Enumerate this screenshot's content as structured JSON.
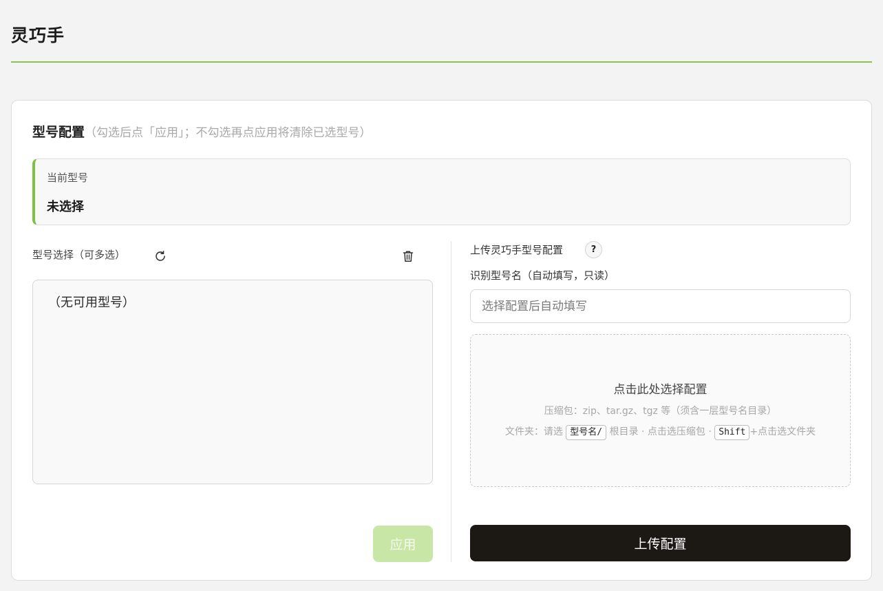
{
  "app": {
    "title": "灵巧手"
  },
  "config": {
    "title": "型号配置",
    "hint": "（勾选后点「应用」；不勾选再点应用将清除已选型号）"
  },
  "current": {
    "label": "当前型号",
    "value": "未选择"
  },
  "selector": {
    "label": "型号选择（可多选）",
    "empty": "（无可用型号）",
    "apply_label": "应用",
    "refresh_icon": "refresh-icon",
    "trash_icon": "trash-icon"
  },
  "upload": {
    "title": "上传灵巧手型号配置",
    "help": "?",
    "name_label": "识别型号名（自动填写，只读）",
    "name_placeholder": "选择配置后自动填写",
    "drop_main": "点击此处选择配置",
    "drop_sub1": "压缩包：zip、tar.gz、tgz 等（须含一层型号名目录）",
    "drop_sub2_a": "文件夹：请选",
    "drop_sub2_kbd1": "型号名/",
    "drop_sub2_b": "根目录 · 点击选压缩包 ·",
    "drop_sub2_kbd2": "Shift",
    "drop_sub2_c": "+点击选文件夹",
    "button_label": "上传配置"
  },
  "colors": {
    "accent": "#8cc152",
    "button_dark": "#1c1915",
    "apply_disabled": "#c8e6a6"
  }
}
